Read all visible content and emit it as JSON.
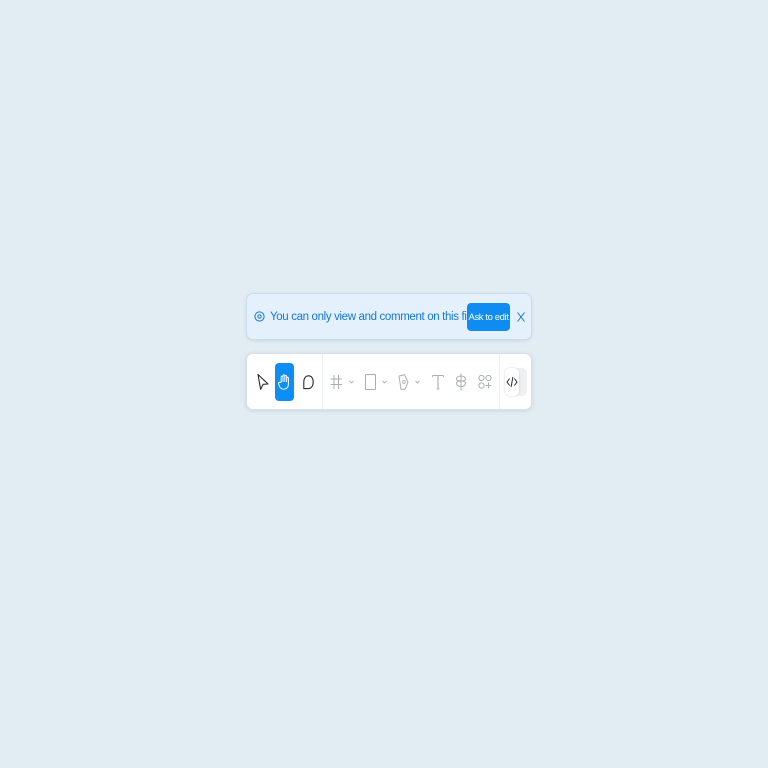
{
  "banner": {
    "icon": "eye-icon",
    "message": "You can only view and comment on this file.",
    "ask_label": "Ask to edit",
    "close_icon": "close-icon"
  },
  "toolbar": {
    "tools": [
      {
        "name": "move-tool",
        "icon": "cursor-arrow-icon",
        "active": false
      },
      {
        "name": "hand-tool",
        "icon": "hand-icon",
        "active": true
      },
      {
        "name": "comment-tool",
        "icon": "comment-bubble-icon",
        "active": false
      },
      {
        "name": "frame-tool",
        "icon": "frame-hash-icon",
        "active": false,
        "has_dropdown": true
      },
      {
        "name": "shape-tool",
        "icon": "rectangle-icon",
        "active": false,
        "has_dropdown": true
      },
      {
        "name": "pen-tool",
        "icon": "pen-nib-icon",
        "active": false,
        "has_dropdown": true
      },
      {
        "name": "text-tool",
        "icon": "text-t-icon",
        "active": false
      },
      {
        "name": "resources-tool",
        "icon": "resources-icon",
        "active": false
      },
      {
        "name": "plugins-tool",
        "icon": "widgets-plus-icon",
        "active": false
      }
    ],
    "dev_mode": {
      "icon": "code-brackets-icon",
      "enabled": false
    }
  },
  "colors": {
    "canvas": "#e2ecf3",
    "banner_bg": "#e4f1fc",
    "banner_text": "#1577d1",
    "accent": "#0d8ef5",
    "icon_dark": "#2b2b2b",
    "icon_muted": "#a9afb5"
  }
}
